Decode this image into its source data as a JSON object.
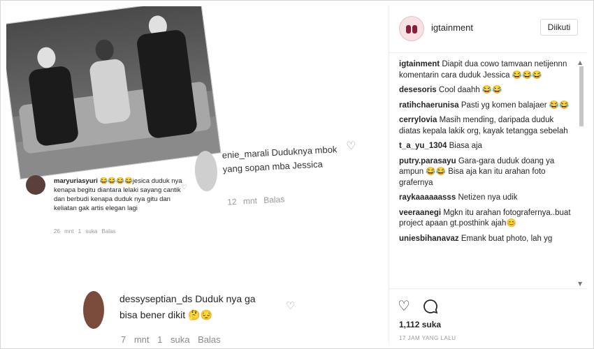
{
  "post": {
    "comments": [
      {
        "user": "maryuriasyuri",
        "text": "😂😂😂😂jesica duduk nya kenapa begitu diantara lelaki sayang cantik dan berbudi kenapa duduk nya gitu dan keliatan gak artis elegan lagi",
        "time": "26 mnt",
        "likes": "1 suka",
        "reply": "Balas"
      },
      {
        "user": "enie_marali",
        "text": "Duduknya mbok yang sopan mba Jessica",
        "time": "12 mnt",
        "reply": "Balas"
      },
      {
        "user": "dessyseptian_ds",
        "text": "Duduk nya ga bisa bener dikit 🤔😔",
        "time": "7 mnt",
        "likes": "1 suka",
        "reply": "Balas"
      }
    ]
  },
  "panel": {
    "username": "igtainment",
    "follow_label": "Diikuti",
    "comments": [
      {
        "user": "igtainment",
        "text": "Diapit dua cowo tamvaan netijennn komentarin cara duduk Jessica 😂😂😂"
      },
      {
        "user": "desesoris",
        "text": "Cool daahh 😂😂"
      },
      {
        "user": "ratihchaerunisa",
        "text": "Pasti yg komen balajaer 😂😂"
      },
      {
        "user": "cerrylovia",
        "text": "Masih mending, daripada duduk diatas kepala lakik org, kayak tetangga sebelah"
      },
      {
        "user": "t_a_yu_1304",
        "text": "Biasa aja"
      },
      {
        "user": "putry.parasayu",
        "text": "Gara-gara duduk doang ya ampun 😂😂 Bisa aja kan itu arahan foto grafernya"
      },
      {
        "user": "raykaaaaaasss",
        "text": "Netizen nya udik"
      },
      {
        "user": "veeraanegi",
        "text": "Mgkn itu arahan fotografernya..buat project apaan gt.posthink ajah😊"
      },
      {
        "user": "uniesbihanavaz",
        "text": "Emank buat photo, lah yg"
      }
    ],
    "likes": "1,112 suka",
    "time": "17 JAM YANG LALU",
    "icons": {
      "like": "heart-icon",
      "comment": "comment-icon"
    }
  }
}
